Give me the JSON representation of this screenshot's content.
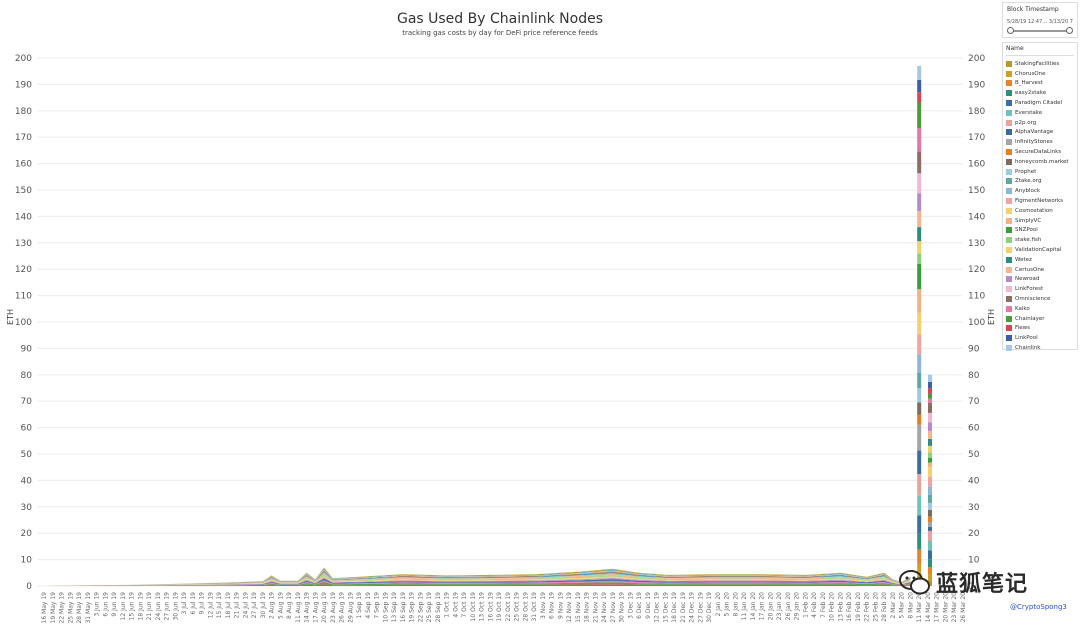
{
  "chart_data": {
    "type": "area",
    "title": "Gas Used By Chainlink Nodes",
    "subtitle": "tracking gas costs by day for DeFi price reference feeds",
    "ylabel": "ETH",
    "ylim": [
      0,
      200
    ],
    "yticks": [
      0,
      10,
      20,
      30,
      40,
      50,
      60,
      70,
      80,
      90,
      100,
      110,
      120,
      130,
      140,
      150,
      160,
      170,
      180,
      190,
      200
    ],
    "x_ticks": [
      "16 May 19",
      "19 May 19",
      "22 May 19",
      "25 May 19",
      "28 May 19",
      "31 May 19",
      "3 Jun 19",
      "6 Jun 19",
      "9 Jun 19",
      "12 Jun 19",
      "15 Jun 19",
      "18 Jun 19",
      "21 Jun 19",
      "24 Jun 19",
      "27 Jun 19",
      "30 Jun 19",
      "3 Jul 19",
      "6 Jul 19",
      "9 Jul 19",
      "12 Jul 19",
      "15 Jul 19",
      "18 Jul 19",
      "21 Jul 19",
      "24 Jul 19",
      "27 Jul 19",
      "30 Jul 19",
      "2 Aug 19",
      "5 Aug 19",
      "8 Aug 19",
      "11 Aug 19",
      "14 Aug 19",
      "17 Aug 19",
      "20 Aug 19",
      "23 Aug 19",
      "26 Aug 19",
      "29 Aug 19",
      "1 Sep 19",
      "4 Sep 19",
      "7 Sep 19",
      "10 Sep 19",
      "13 Sep 19",
      "16 Sep 19",
      "19 Sep 19",
      "22 Sep 19",
      "25 Sep 19",
      "28 Sep 19",
      "1 Oct 19",
      "4 Oct 19",
      "7 Oct 19",
      "10 Oct 19",
      "13 Oct 19",
      "16 Oct 19",
      "19 Oct 19",
      "22 Oct 19",
      "25 Oct 19",
      "28 Oct 19",
      "31 Oct 19",
      "3 Nov 19",
      "6 Nov 19",
      "9 Nov 19",
      "12 Nov 19",
      "15 Nov 19",
      "18 Nov 19",
      "21 Nov 19",
      "24 Nov 19",
      "27 Nov 19",
      "30 Nov 19",
      "3 Dec 19",
      "6 Dec 19",
      "9 Dec 19",
      "12 Dec 19",
      "15 Dec 19",
      "18 Dec 19",
      "21 Dec 19",
      "24 Dec 19",
      "27 Dec 19",
      "30 Dec 19",
      "2 Jan 20",
      "5 Jan 20",
      "8 Jan 20",
      "11 Jan 20",
      "14 Jan 20",
      "17 Jan 20",
      "20 Jan 20",
      "23 Jan 20",
      "26 Jan 20",
      "29 Jan 20",
      "1 Feb 20",
      "4 Feb 20",
      "7 Feb 20",
      "10 Feb 20",
      "13 Feb 20",
      "16 Feb 20",
      "19 Feb 20",
      "22 Feb 20",
      "25 Feb 20",
      "28 Feb 20",
      "2 Mar 20",
      "5 Mar 20",
      "8 Mar 20",
      "11 Mar 20",
      "14 Mar 20",
      "17 Mar 20",
      "20 Mar 20",
      "23 Mar 20",
      "26 Mar 20"
    ],
    "total_series": {
      "x": [
        "16 May 19",
        "31 May 19",
        "15 Jun 19",
        "30 Jun 19",
        "15 Jul 19",
        "30 Jul 19",
        "2 Aug 19",
        "5 Aug 19",
        "11 Aug 19",
        "14 Aug 19",
        "17 Aug 19",
        "20 Aug 19",
        "23 Aug 19",
        "1 Sep 19",
        "16 Sep 19",
        "1 Oct 19",
        "16 Oct 19",
        "1 Nov 19",
        "16 Nov 19",
        "27 Nov 19",
        "6 Dec 19",
        "16 Dec 19",
        "1 Jan 20",
        "16 Jan 20",
        "1 Feb 20",
        "13 Feb 20",
        "22 Feb 20",
        "28 Feb 20",
        "2 Mar 20",
        "5 Mar 20",
        "8 Mar 20",
        "11 Mar 20",
        "14 Mar 20",
        "17 Mar 20"
      ],
      "y": [
        0,
        0.3,
        0.4,
        0.8,
        1.2,
        1.8,
        4,
        2,
        2,
        5,
        2.5,
        7,
        3,
        3.5,
        4.5,
        4,
        4.2,
        4.5,
        5.5,
        6.5,
        5,
        4.2,
        4.5,
        4.5,
        4.2,
        5,
        3.5,
        5,
        2.5,
        1.5,
        3.5,
        197,
        80,
        0
      ]
    },
    "series": [
      {
        "name": "StakingFacilities",
        "color": "#b6992d"
      },
      {
        "name": "ChorusOne",
        "color": "#c9a227"
      },
      {
        "name": "B_Harvest",
        "color": "#e8832d"
      },
      {
        "name": "easy2stake",
        "color": "#2f8f7f"
      },
      {
        "name": "Paradigm Citadel",
        "color": "#3a6ea5"
      },
      {
        "name": "Everstake",
        "color": "#6fc2b8"
      },
      {
        "name": "p2p.org",
        "color": "#e8a3a0"
      },
      {
        "name": "AlphaVantage",
        "color": "#3e6b9c"
      },
      {
        "name": "InfinityStones",
        "color": "#a5a5a5"
      },
      {
        "name": "SecureDataLinks",
        "color": "#e67e22"
      },
      {
        "name": "honeycomb.market",
        "color": "#7d6b5d"
      },
      {
        "name": "Prophet",
        "color": "#9ecae1"
      },
      {
        "name": "Ztake.org",
        "color": "#5fa8a0"
      },
      {
        "name": "Anyblock",
        "color": "#8fb6d9"
      },
      {
        "name": "FigmentNetworks",
        "color": "#f2a3a3"
      },
      {
        "name": "Cosmostation",
        "color": "#f4d06f"
      },
      {
        "name": "SimplyVC",
        "color": "#f4b183"
      },
      {
        "name": "SNZPool",
        "color": "#3a9d3a"
      },
      {
        "name": "stake.fish",
        "color": "#8fd07a"
      },
      {
        "name": "ValidationCapital",
        "color": "#f6d16a"
      },
      {
        "name": "Wetez",
        "color": "#2e8b7d"
      },
      {
        "name": "CertusOne",
        "color": "#f7b58f"
      },
      {
        "name": "Newroad",
        "color": "#b38bc9"
      },
      {
        "name": "LinkForest",
        "color": "#f4b6d2"
      },
      {
        "name": "Omniscience",
        "color": "#8c6d62"
      },
      {
        "name": "Kaiko",
        "color": "#e377a6"
      },
      {
        "name": "Chainlayer",
        "color": "#4a9b3a"
      },
      {
        "name": "Fiews",
        "color": "#d64550"
      },
      {
        "name": "LinkPool",
        "color": "#3b5fa8"
      },
      {
        "name": "Chainlink",
        "color": "#a6c8e8"
      }
    ]
  },
  "filter": {
    "title": "Block Timestamp",
    "range_text": "5/28/19 12:47… 3/13/20 7:11:…"
  },
  "legend": {
    "title": "Name"
  },
  "watermark": {
    "text": "蓝狐笔记"
  },
  "credit": {
    "text": "@CryptoSpong3"
  }
}
